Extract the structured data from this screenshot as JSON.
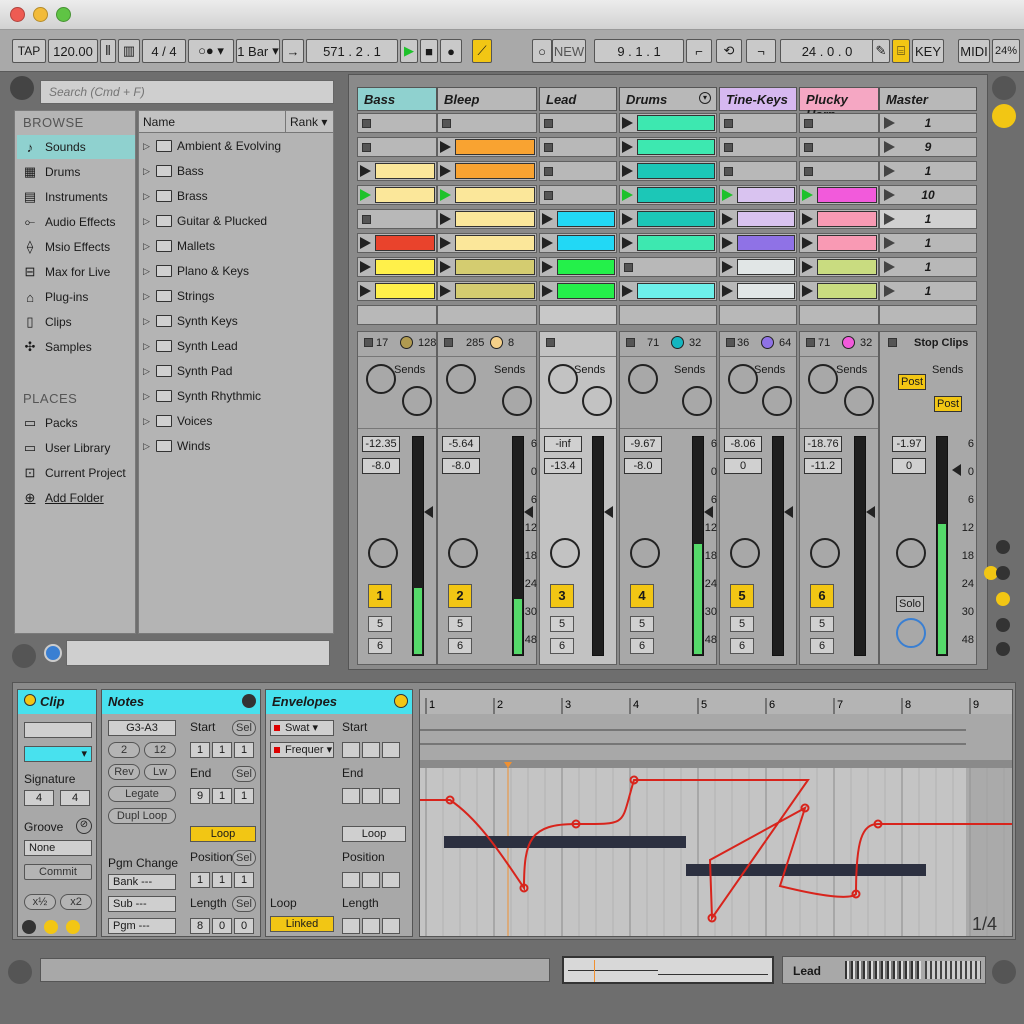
{
  "control": {
    "tap": "TAP",
    "tempo": "120.00",
    "meter": "4 / 4",
    "quant": "1 Bar",
    "position": "571 .  2 .  1",
    "new": "NEW",
    "loop_start": "9 .  1 .  1",
    "loop_len": "24 .  0 .  0",
    "key": "KEY",
    "midi": "MIDI",
    "cpu": "24%"
  },
  "browser": {
    "search_placeholder": "Search (Cmd + F)",
    "browse_label": "BROWSE",
    "places_label": "PLACES",
    "categories": [
      "Sounds",
      "Drums",
      "Instruments",
      "Audio Effects",
      "Msio Effects",
      "Max for Live",
      "Plug-ins",
      "Clips",
      "Samples"
    ],
    "places": [
      "Packs",
      "User Library",
      "Current Project",
      "Add Folder"
    ],
    "col_name": "Name",
    "col_rank": "Rank",
    "items": [
      "Ambient & Evolving",
      "Bass",
      "Brass",
      "Guitar & Plucked",
      "Mallets",
      "Plano & Keys",
      "Strings",
      "Synth Keys",
      "Synth Lead",
      "Synth Pad",
      "Synth Rhythmic",
      "Voices",
      "Winds"
    ]
  },
  "session": {
    "tracks": [
      {
        "name": "Bass",
        "color": "#8fd1cf"
      },
      {
        "name": "Bleep",
        "color": "#b8b8b8"
      },
      {
        "name": "Lead",
        "color": "#b8b8b8"
      },
      {
        "name": "Drums",
        "color": "#b8b8b8"
      },
      {
        "name": "Tine-Keys",
        "color": "#d6b8f0"
      },
      {
        "name": "Plucky Harp",
        "color": "#f5a7c3"
      }
    ],
    "master_name": "Master",
    "master_scenes": [
      "1",
      "9",
      "1",
      "10",
      "1",
      "1",
      "1",
      "1"
    ],
    "stop_clips": "Stop Clips",
    "strips": [
      {
        "top_a": "17",
        "top_b": "128",
        "sends": "Sends",
        "vol": "-12.35",
        "pan": "-8.0",
        "num": "1",
        "s1": "5",
        "s2": "6",
        "level": 0.3
      },
      {
        "top_a": "285",
        "top_b": "8",
        "sends": "Sends",
        "vol": "-5.64",
        "pan": "-8.0",
        "num": "2",
        "s1": "5",
        "s2": "6",
        "level": 0.25
      },
      {
        "top_a": "",
        "top_b": "",
        "sends": "Sends",
        "vol": "-inf",
        "pan": "-13.4",
        "num": "3",
        "s1": "5",
        "s2": "6",
        "level": 0
      },
      {
        "top_a": "71",
        "top_b": "32",
        "sends": "Sends",
        "vol": "-9.67",
        "pan": "-8.0",
        "num": "4",
        "s1": "5",
        "s2": "6",
        "level": 0.5
      },
      {
        "top_a": "36",
        "top_b": "64",
        "sends": "Sends",
        "vol": "-8.06",
        "pan": "0",
        "num": "5",
        "s1": "5",
        "s2": "6",
        "level": 0
      },
      {
        "top_a": "71",
        "top_b": "32",
        "sends": "Sends",
        "vol": "-18.76",
        "pan": "-11.2",
        "num": "6",
        "s1": "5",
        "s2": "6",
        "level": 0
      }
    ],
    "master_strip": {
      "vol": "-1.97",
      "pan": "0",
      "post1": "Post",
      "post2": "Post",
      "sends": "Sends",
      "solo": "Solo"
    },
    "db_scale": [
      "6",
      "0",
      "6",
      "12",
      "18",
      "24",
      "30",
      "48"
    ]
  },
  "detail": {
    "clip": {
      "title": "Clip",
      "signature": "Signature",
      "sig_num": "4",
      "sig_den": "4",
      "groove": "Groove",
      "groove_val": "None",
      "commit": "Commit"
    },
    "notes": {
      "title": "Notes",
      "range": "G3-A3",
      "b1": "2",
      "b2": "12",
      "rev": "Rev",
      "lw": "Lw",
      "legato": "Legate",
      "dupl": "Dupl Loop",
      "start": "Start",
      "end": "End",
      "sel": "Sel",
      "start_v": [
        "1",
        "1",
        "1"
      ],
      "end_v": [
        "9",
        "1",
        "1"
      ],
      "loop": "Loop",
      "position": "Position",
      "pos_v": [
        "1",
        "1",
        "1"
      ],
      "length": "Length",
      "len_v": [
        "8",
        "0",
        "0"
      ],
      "pgm_change": "Pgm Change",
      "bank": "Bank ---",
      "sub": "Sub ---",
      "pgm": "Pgm ---"
    },
    "env": {
      "title": "Envelopes",
      "dev": "Swat",
      "param": "Frequer",
      "start": "Start",
      "end": "End",
      "loop": "Loop",
      "position": "Position",
      "length": "Length",
      "loop_label": "Loop",
      "linked": "Linked"
    },
    "ruler": [
      "1",
      "2",
      "3",
      "4",
      "5",
      "6",
      "7",
      "8",
      "9"
    ],
    "zoom": "1/4"
  },
  "bottom": {
    "track_label": "Lead"
  }
}
